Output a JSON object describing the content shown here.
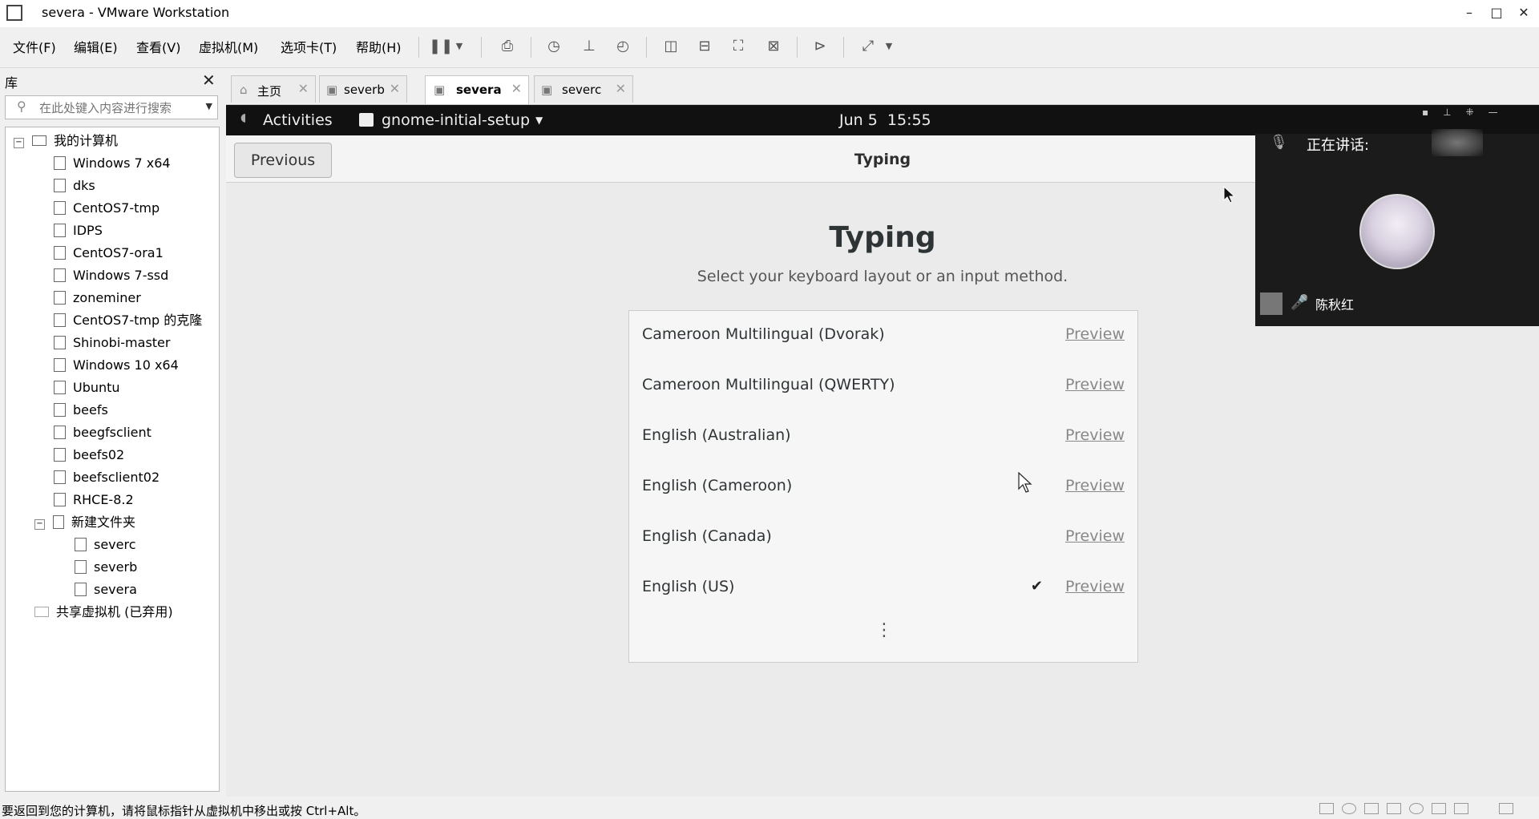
{
  "window": {
    "title": "severa - VMware Workstation",
    "minimize": "–",
    "maximize": "□",
    "close": "✕"
  },
  "menu": [
    "文件(F)",
    "编辑(E)",
    "查看(V)",
    "虚拟机(M)",
    "选项卡(T)",
    "帮助(H)"
  ],
  "toolbar_icons": [
    "pause-icon",
    "dropdown-arrow-icon",
    "send-ctrl-alt-del-icon",
    "snapshot-icon",
    "revert-snapshot-icon",
    "snapshot-manager-icon",
    "library-view-icon",
    "thumbnail-view-icon",
    "full-screen-icon",
    "unity-icon",
    "console-icon",
    "stretch-icon",
    "dropdown-arrow-icon"
  ],
  "library": {
    "title": "库",
    "close": "✕",
    "search_placeholder": "在此处键入内容进行搜索",
    "root": "我的计算机",
    "vms": [
      "Windows 7 x64",
      "dks",
      "CentOS7-tmp",
      "IDPS",
      "CentOS7-ora1",
      "Windows 7-ssd",
      "zoneminer",
      "CentOS7-tmp 的克隆",
      "Shinobi-master",
      "Windows 10 x64",
      "Ubuntu",
      "beefs",
      "beegfsclient",
      "beefs02",
      "beefsclient02",
      "RHCE-8.2"
    ],
    "folder": "新建文件夹",
    "folder_vms": [
      "severc",
      "severb",
      "severa"
    ],
    "shared": "共享虚拟机 (已弃用)"
  },
  "tabs": [
    {
      "label": "主页",
      "active": false
    },
    {
      "label": "severb",
      "active": false
    },
    {
      "label": "severa",
      "active": true
    },
    {
      "label": "severc",
      "active": false
    }
  ],
  "gnome": {
    "activities": "Activities",
    "app_menu": "gnome-initial-setup",
    "clock": "Jun 5  15:55",
    "previous": "Previous",
    "header_title": "Typing",
    "title": "Typing",
    "subtitle": "Select your keyboard layout or an input method.",
    "preview": "Preview",
    "layouts": [
      {
        "name": "Cameroon Multilingual (Dvorak)",
        "selected": false
      },
      {
        "name": "Cameroon Multilingual (QWERTY)",
        "selected": false
      },
      {
        "name": "English (Australian)",
        "selected": false
      },
      {
        "name": "English (Cameroon)",
        "selected": false
      },
      {
        "name": "English (Canada)",
        "selected": false
      },
      {
        "name": "English (US)",
        "selected": true
      }
    ],
    "check": "✔",
    "more": "⋮"
  },
  "meeting": {
    "speaking_label": "正在讲话:",
    "user_name": "陈秋红"
  },
  "status": {
    "text": "要返回到您的计算机，请将鼠标指针从虚拟机中移出或按 Ctrl+Alt。"
  }
}
